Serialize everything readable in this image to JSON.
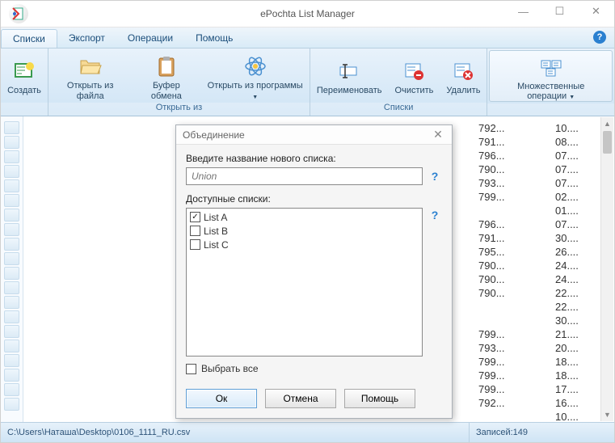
{
  "window": {
    "title": "ePochta List Manager"
  },
  "tabs": {
    "items": [
      "Списки",
      "Экспорт",
      "Операции",
      "Помощь"
    ],
    "active": 0
  },
  "ribbon": {
    "create": "Создать",
    "open_file": "Открыть из файла",
    "open_clipboard": "Буфер обмена",
    "open_program": "Открыть из программы",
    "group_open": "Открыть из",
    "rename": "Переименовать",
    "clear": "Очистить",
    "delete": "Удалить",
    "group_lists": "Списки",
    "multi": "Множественные операции"
  },
  "dialog": {
    "title": "Объединение",
    "prompt": "Введите название нового списка:",
    "input_placeholder": "Union",
    "available": "Доступные списки:",
    "lists": [
      {
        "label": "List A",
        "checked": true
      },
      {
        "label": "List B",
        "checked": false
      },
      {
        "label": "List C",
        "checked": false
      }
    ],
    "select_all": "Выбрать все",
    "ok": "Ок",
    "cancel": "Отмена",
    "help": "Помощь"
  },
  "data_rows": [
    {
      "a": "792...",
      "b": "10...."
    },
    {
      "a": "791...",
      "b": "08...."
    },
    {
      "a": "796...",
      "b": "07...."
    },
    {
      "a": "790...",
      "b": "07...."
    },
    {
      "a": "793...",
      "b": "07...."
    },
    {
      "a": "799...",
      "b": "02...."
    },
    {
      "a": "",
      "b": "01...."
    },
    {
      "a": "796...",
      "b": "07...."
    },
    {
      "a": "791...",
      "b": "30...."
    },
    {
      "a": "795...",
      "b": "26...."
    },
    {
      "a": "790...",
      "b": "24...."
    },
    {
      "a": "790...",
      "b": "24...."
    },
    {
      "a": "790...",
      "b": "22...."
    },
    {
      "a": "",
      "b": "22...."
    },
    {
      "a": "",
      "b": "30...."
    },
    {
      "a": "799...",
      "b": "21...."
    },
    {
      "a": "793...",
      "b": "20...."
    },
    {
      "a": "799...",
      "b": "18...."
    },
    {
      "a": "799...",
      "b": "18...."
    },
    {
      "a": "799...",
      "b": "17...."
    },
    {
      "a": "792...",
      "b": "16...."
    },
    {
      "a": "",
      "b": "10...."
    }
  ],
  "status": {
    "path": "C:\\Users\\Наташа\\Desktop\\0106_1111_RU.csv",
    "records": "Записей:149"
  }
}
